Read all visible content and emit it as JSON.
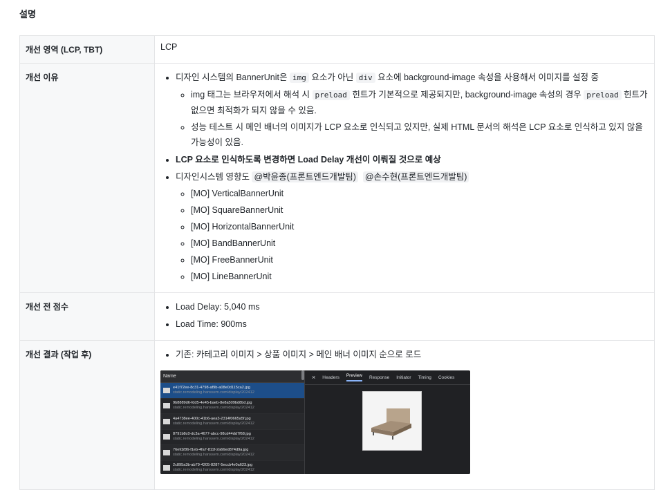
{
  "heading": "설명",
  "rows": {
    "area": {
      "label": "개선 영역 (LCP, TBT)",
      "value": "LCP"
    },
    "reason": {
      "label": "개선 이유",
      "b1": {
        "t1": "디자인 시스템의 BannerUnit은 ",
        "c1": "img",
        "t2": " 요소가 아닌 ",
        "c2": "div",
        "t3": " 요소에 background-image 속성을 사용해서 이미지를 설정 중"
      },
      "b1_sub1": {
        "t1": "img 태그는 브라우저에서 해석 시 ",
        "c1": "preload",
        "t2": " 힌트가 기본적으로 제공되지만, background-image 속성의 경우 ",
        "c2": "preload",
        "t3": " 힌트가 없으면 최적화가 되지 않을 수 있음."
      },
      "b1_sub2": "성능 테스트 시 메인 배너의 이미지가 LCP 요소로 인식되고 있지만, 실제 HTML 문서의 해석은 LCP 요소로 인식하고 있지 않을 가능성이 있음.",
      "b2": "LCP 요소로 인식하도록 변경하면 Load Delay 개선이 이뤄질 것으로 예상",
      "b3": {
        "text": "디자인시스템 영향도 ",
        "m1": "@박윤종(프론트엔드개발팀)",
        "m2": "@손수현(프론트엔드개발팀)"
      },
      "units": [
        "[MO] VerticalBannerUnit",
        "[MO] SquareBannerUnit",
        "[MO] HorizontalBannerUnit",
        "[MO] BandBannerUnit",
        "[MO] FreeBannerUnit",
        "[MO] LineBannerUnit"
      ]
    },
    "before": {
      "label": "개선 전 점수",
      "items": [
        "Load Delay: 5,040 ms",
        "Load Time: 900ms"
      ]
    },
    "result": {
      "label": "개선 결과 (작업 후)",
      "item": "기존: 카테고리 이미지 > 상품 이미지 > 메인 배너 이미지 순으로 로드",
      "devtools": {
        "name_header": "Name",
        "tabs": [
          "Headers",
          "Preview",
          "Response",
          "Initiator",
          "Timing",
          "Cookies"
        ],
        "files": [
          {
            "file": "e41f72ee-8c31-4798-af9b-a08e0d115ca2.jpg",
            "host": "static.remodeling.hanssem.com/display/202412"
          },
          {
            "file": "9b8889d6-fdd5-4e45-baeb-8e8a509bd8bd.jpg",
            "host": "static.remodeling.hanssem.com/display/202412"
          },
          {
            "file": "4a4738ee-400c-41b6-aea3-2314f0665a5f.jpg",
            "host": "static.remodeling.hanssem.com/display/202412"
          },
          {
            "file": "8791b8c0-dc3a-4677-abcc-98cd44dd7f68.jpg",
            "host": "static.remodeling.hanssem.com/display/202412"
          },
          {
            "file": "76efd286-f1eb-4fa7-811f-2a66ed874d9a.jpg",
            "host": "static.remodeling.hanssem.com/display/202412"
          },
          {
            "file": "2c895a3b-ab79-4205-8287-5eccb4e0a623.jpg",
            "host": "static.remodeling.hanssem.com/display/202412"
          }
        ]
      }
    }
  }
}
